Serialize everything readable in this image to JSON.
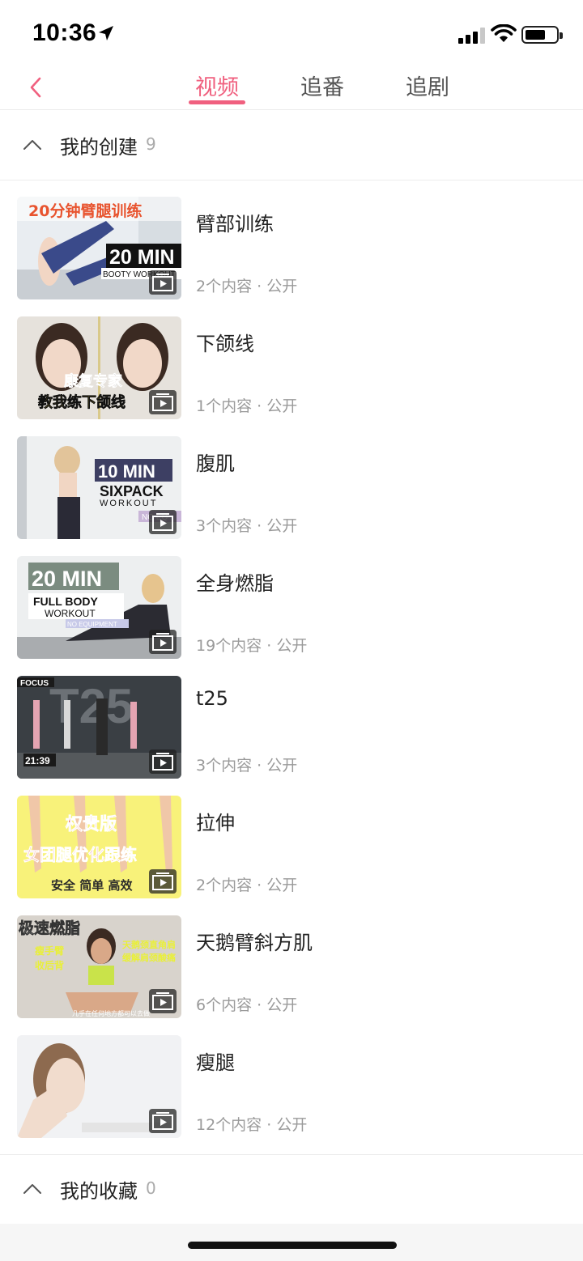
{
  "status_bar": {
    "time": "10:36"
  },
  "nav": {
    "tabs": [
      {
        "label": "视频",
        "active": true
      },
      {
        "label": "追番",
        "active": false
      },
      {
        "label": "追剧",
        "active": false
      }
    ],
    "accent_color": "#f0607f"
  },
  "created_section": {
    "title": "我的创建",
    "count": "9"
  },
  "playlists": [
    {
      "title": "臂部训练",
      "count": "2个内容",
      "visibility": "公开",
      "thumb_text": [
        "20分钟臂腿训练",
        "20 MIN",
        "BOOTY WORKOUT"
      ]
    },
    {
      "title": "下颌线",
      "count": "1个内容",
      "visibility": "公开",
      "thumb_text": [
        "康复专家",
        "教我练下颌线"
      ]
    },
    {
      "title": "腹肌",
      "count": "3个内容",
      "visibility": "公开",
      "thumb_text": [
        "10 MIN",
        "SIXPACK",
        "WORKOUT",
        "NO EQ"
      ]
    },
    {
      "title": "全身燃脂",
      "count": "19个内容",
      "visibility": "公开",
      "thumb_text": [
        "20 MIN",
        "FULL BODY",
        "WORKOUT",
        "NO EQUIPMENT"
      ]
    },
    {
      "title": "t25",
      "count": "3个内容",
      "visibility": "公开",
      "thumb_text": [
        "FOCUS",
        "T25",
        "21:39"
      ]
    },
    {
      "title": "拉伸",
      "count": "2个内容",
      "visibility": "公开",
      "thumb_text": [
        "权贵版",
        "女团腿优化跟练",
        "安全 简单 高效"
      ]
    },
    {
      "title": "天鹅臂斜方肌",
      "count": "6个内容",
      "visibility": "公开",
      "thumb_text": [
        "极速燃脂",
        "瘦手臂",
        "收后背",
        "天鹅颈直角肩",
        "缓解肩颈酸痛",
        "几乎在任何地方都可以去做"
      ]
    },
    {
      "title": "瘦腿",
      "count": "12个内容",
      "visibility": "公开",
      "thumb_text": []
    }
  ],
  "favorites_section": {
    "title": "我的收藏",
    "count": "0"
  },
  "icons": {
    "back": "chevron-left-icon",
    "collapse": "chevron-up-icon",
    "play": "play-badge-icon",
    "location": "location-arrow-icon",
    "signal": "cellular-signal-icon",
    "wifi": "wifi-icon",
    "battery": "battery-icon"
  }
}
